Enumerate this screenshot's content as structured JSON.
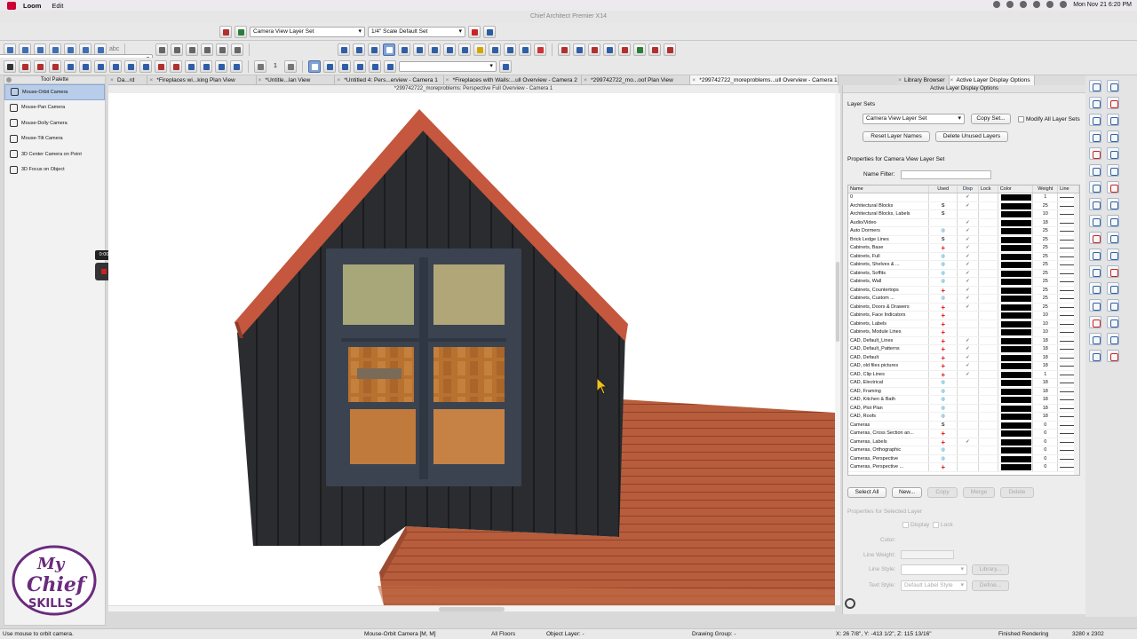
{
  "menubar": {
    "app": "Loom",
    "edit": "Edit",
    "datetime": "Mon Nov 21  6:20 PM"
  },
  "window_title": "Chief Architect Premier X14",
  "toolbar": {
    "layer_set": "Camera View Layer Set",
    "scale_set": "1/4\" Scale Default Set",
    "counter_value": "1",
    "spell_label": "abc"
  },
  "palette": {
    "title": "Tool Palette",
    "items": [
      "Mouse-Orbit Camera",
      "Mouse-Pan Camera",
      "Mouse-Dolly Camera",
      "Mouse-Tilt Camera",
      "3D Center Camera on Point",
      "3D Focus on Object"
    ]
  },
  "recorder": {
    "time": "0:00"
  },
  "view_tabs": [
    "Da...rd",
    "*Fireplaces wi...king Plan View",
    "*Untitle...lan View",
    "*Untitled 4: Pers...erview - Camera 1",
    "*Fireplaces with Walls:...ull Overview - Camera 2",
    "*299742722_mo...oof Plan View",
    "*299742722_moreproblems...ull Overview - Camera 1"
  ],
  "view_title": "*299742722_moreproblems: Perspective Full Overview - Camera 1",
  "right_tabs": [
    "Library Browser",
    "Active Layer Display Options"
  ],
  "panel": {
    "title": "Active Layer Display Options",
    "layer_sets_label": "Layer Sets",
    "layer_set_value": "Camera View Layer Set",
    "copy_set": "Copy Set...",
    "modify_all": "Modify All Layer Sets",
    "reset_names": "Reset Layer Names",
    "delete_unused": "Delete Unused Layers",
    "properties_for": "Properties for Camera View Layer Set",
    "name_filter": "Name Filter:",
    "columns": [
      "Name",
      "Used",
      "Disp",
      "Lock",
      "Color",
      "Weight",
      "Line"
    ],
    "rows": [
      {
        "name": "0",
        "used": "",
        "disp": "✓",
        "weight": "1"
      },
      {
        "name": "Architectural Blocks",
        "used": "S",
        "disp": "✓",
        "weight": "25"
      },
      {
        "name": "Architectural Blocks, Labels",
        "used": "S",
        "disp": "",
        "weight": "10"
      },
      {
        "name": "Audio/Video",
        "used": "",
        "disp": "✓",
        "weight": "18"
      },
      {
        "name": "Auto Dormers",
        "used": "eye",
        "disp": "✓",
        "weight": "25"
      },
      {
        "name": "Brick Ledge Lines",
        "used": "S",
        "disp": "✓",
        "weight": "25"
      },
      {
        "name": "Cabinets,  Base",
        "used": "+",
        "disp": "✓",
        "weight": "25"
      },
      {
        "name": "Cabinets,  Full",
        "used": "eye",
        "disp": "✓",
        "weight": "25"
      },
      {
        "name": "Cabinets,  Shelves & ...",
        "used": "eye",
        "disp": "✓",
        "weight": "25"
      },
      {
        "name": "Cabinets,  Soffits",
        "used": "eye",
        "disp": "✓",
        "weight": "25"
      },
      {
        "name": "Cabinets,  Wall",
        "used": "eye",
        "disp": "✓",
        "weight": "25"
      },
      {
        "name": "Cabinets, Countertops",
        "used": "+",
        "disp": "✓",
        "weight": "25"
      },
      {
        "name": "Cabinets, Custom ...",
        "used": "eye",
        "disp": "✓",
        "weight": "25"
      },
      {
        "name": "Cabinets, Doors & Drawers",
        "used": "+",
        "disp": "✓",
        "weight": "25"
      },
      {
        "name": "Cabinets, Face Indicators",
        "used": "+",
        "disp": "",
        "weight": "10"
      },
      {
        "name": "Cabinets, Labels",
        "used": "+",
        "disp": "",
        "weight": "10"
      },
      {
        "name": "Cabinets, Module Lines",
        "used": "+",
        "disp": "",
        "weight": "10"
      },
      {
        "name": "CAD,  Default_Lines",
        "used": "+",
        "disp": "✓",
        "weight": "18"
      },
      {
        "name": "CAD,  Default_Patterns",
        "used": "+",
        "disp": "✓",
        "weight": "18"
      },
      {
        "name": "CAD,  Default",
        "used": "+",
        "disp": "✓",
        "weight": "18"
      },
      {
        "name": "CAD,  old files pictures",
        "used": "+",
        "disp": "✓",
        "weight": "18"
      },
      {
        "name": "CAD, Clip Lines",
        "used": "+",
        "disp": "✓",
        "weight": "1"
      },
      {
        "name": "CAD, Electrical",
        "used": "eye",
        "disp": "",
        "weight": "18"
      },
      {
        "name": "CAD, Framing",
        "used": "eye",
        "disp": "",
        "weight": "18"
      },
      {
        "name": "CAD, Kitchen & Bath",
        "used": "eye",
        "disp": "",
        "weight": "18"
      },
      {
        "name": "CAD, Plot Plan",
        "used": "eye",
        "disp": "",
        "weight": "18"
      },
      {
        "name": "CAD, Roofs",
        "used": "eye",
        "disp": "",
        "weight": "18"
      },
      {
        "name": "Cameras",
        "used": "S",
        "disp": "",
        "weight": "0"
      },
      {
        "name": "Cameras, Cross Section an...",
        "used": "+",
        "disp": "",
        "weight": "0"
      },
      {
        "name": "Cameras, Labels",
        "used": "+",
        "disp": "✓",
        "weight": "0"
      },
      {
        "name": "Cameras, Orthographic",
        "used": "eye",
        "disp": "",
        "weight": "0"
      },
      {
        "name": "Cameras, Perspective",
        "used": "eye",
        "disp": "",
        "weight": "0"
      },
      {
        "name": "Cameras, Perspective ...",
        "used": "+",
        "disp": "",
        "weight": "0"
      }
    ],
    "select_all": "Select All",
    "new": "New...",
    "copy": "Copy",
    "merge": "Merge",
    "delete": "Delete",
    "props_selected": "Properties for Selected Layer",
    "display": "Display",
    "lock": "Lock",
    "color": "Color:",
    "line_weight": "Line Weight:",
    "line_style": "Line Style:",
    "library": "Library...",
    "text_style": "Text Style:",
    "text_style_value": "Default Label Style",
    "define": "Define..."
  },
  "status": {
    "hint": "Use mouse to orbit camera.",
    "tool": "Mouse-Orbit Camera [M, M]",
    "floors": "All Floors",
    "object_layer": "Object Layer: -",
    "drawing_group": "Drawing Group: -",
    "coords": "X: 26 7/8\", Y: -413 1/2\", Z: 115 13/16\"",
    "render": "Finished Rendering",
    "size": "3280 x 2302"
  },
  "logo": {
    "line1": "My",
    "line2": "Chief",
    "line3": "SKILLS"
  },
  "colors": {
    "siding": "#26282b",
    "trim": "#c4573d",
    "deck": "#b35a3a",
    "frame": "#3b4350",
    "accent": "#7fa2d6"
  }
}
